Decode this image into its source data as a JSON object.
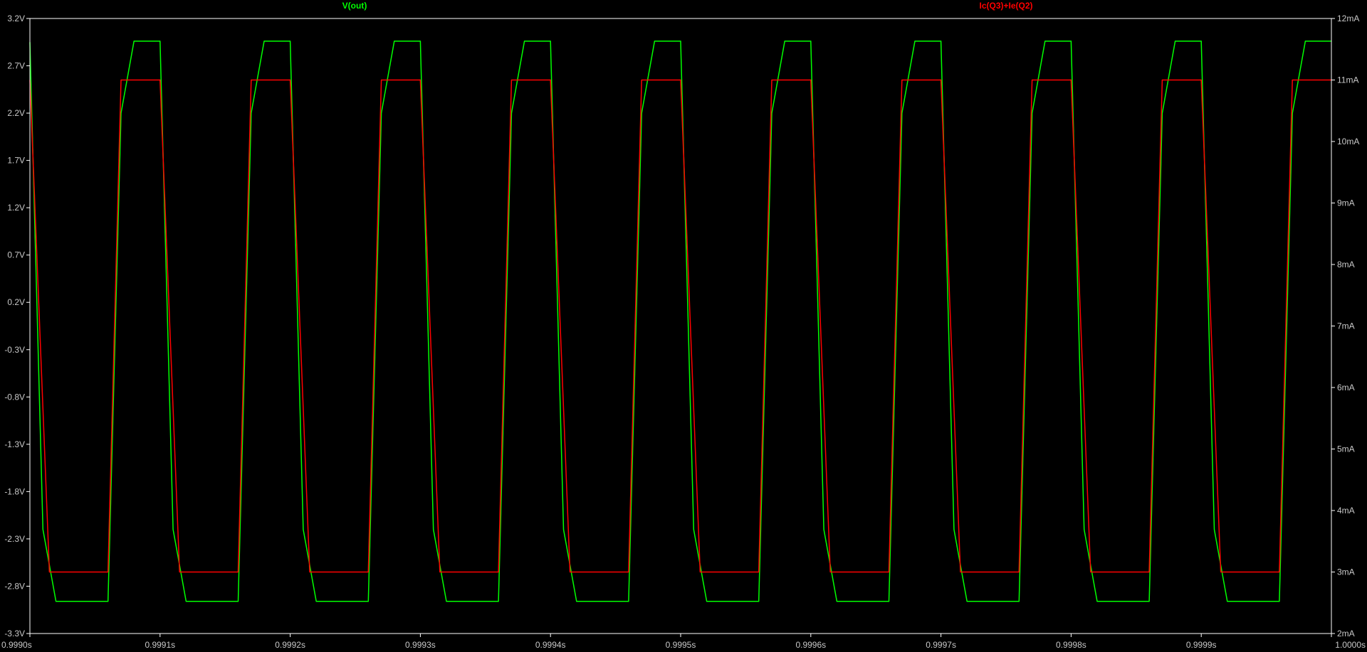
{
  "chart_data": {
    "type": "line",
    "background": "#000000",
    "axis_color": "#ffffff",
    "tick_label_color": "#c8c8c8",
    "grid": false,
    "x_axis": {
      "range": [
        0.999,
        1.0
      ],
      "unit": "s",
      "tick_labels": [
        "0.9990s",
        "0.9991s",
        "0.9992s",
        "0.9993s",
        "0.9994s",
        "0.9995s",
        "0.9996s",
        "0.9997s",
        "0.9998s",
        "0.9999s",
        "1.0000s"
      ],
      "tick_values": [
        0.999,
        0.9991,
        0.9992,
        0.9993,
        0.9994,
        0.9995,
        0.9996,
        0.9997,
        0.9998,
        0.9999,
        1.0
      ]
    },
    "y_left": {
      "range": [
        -3.3,
        3.2
      ],
      "unit": "V",
      "tick_labels": [
        "3.2V",
        "2.7V",
        "2.2V",
        "1.7V",
        "1.2V",
        "0.7V",
        "0.2V",
        "-0.3V",
        "-0.8V",
        "-1.3V",
        "-1.8V",
        "-2.3V",
        "-2.8V",
        "-3.3V"
      ],
      "tick_values": [
        3.2,
        2.7,
        2.2,
        1.7,
        1.2,
        0.7,
        0.2,
        -0.3,
        -0.8,
        -1.3,
        -1.8,
        -2.3,
        -2.8,
        -3.3
      ]
    },
    "y_right": {
      "range": [
        2,
        12
      ],
      "unit": "mA",
      "tick_labels": [
        "12mA",
        "11mA",
        "10mA",
        "9mA",
        "8mA",
        "7mA",
        "6mA",
        "5mA",
        "4mA",
        "3mA",
        "2mA"
      ],
      "tick_values": [
        12,
        11,
        10,
        9,
        8,
        7,
        6,
        5,
        4,
        3,
        2
      ]
    },
    "series": [
      {
        "name": "V(out)",
        "color": "#00ff00",
        "axis": "left",
        "x": [
          0.999,
          0.99901,
          0.99902,
          0.99906,
          0.99907,
          0.99908,
          0.9991,
          0.99911,
          0.99912,
          0.99916,
          0.99917,
          0.99918,
          0.9992,
          0.99921,
          0.99922,
          0.99926,
          0.99927,
          0.99928,
          0.9993,
          0.99931,
          0.99932,
          0.99936,
          0.99937,
          0.99938,
          0.9994,
          0.99941,
          0.99942,
          0.99946,
          0.99947,
          0.99948,
          0.9995,
          0.99951,
          0.99952,
          0.99956,
          0.99957,
          0.99958,
          0.9996,
          0.99961,
          0.99962,
          0.99966,
          0.99967,
          0.99968,
          0.9997,
          0.99971,
          0.99972,
          0.99976,
          0.99977,
          0.99978,
          0.9998,
          0.99981,
          0.99982,
          0.99986,
          0.99987,
          0.99988,
          0.9999,
          0.99991,
          0.99992,
          0.99996,
          0.99997,
          0.99998,
          1.0
        ],
        "y": [
          2.95,
          -2.2,
          -2.96,
          -2.96,
          2.2,
          2.96,
          2.96,
          -2.2,
          -2.96,
          -2.96,
          2.2,
          2.96,
          2.96,
          -2.2,
          -2.96,
          -2.96,
          2.2,
          2.96,
          2.96,
          -2.2,
          -2.96,
          -2.96,
          2.2,
          2.96,
          2.96,
          -2.2,
          -2.96,
          -2.96,
          2.2,
          2.96,
          2.96,
          -2.2,
          -2.96,
          -2.96,
          2.2,
          2.96,
          2.96,
          -2.2,
          -2.96,
          -2.96,
          2.2,
          2.96,
          2.96,
          -2.2,
          -2.96,
          -2.96,
          2.2,
          2.96,
          2.96,
          -2.2,
          -2.96,
          -2.96,
          2.2,
          2.96,
          2.96,
          -2.2,
          -2.96,
          -2.96,
          2.2,
          2.96,
          2.96
        ]
      },
      {
        "name": "Ic(Q3)+Ie(Q2)",
        "color": "#ff0000",
        "axis": "right",
        "x": [
          0.999,
          0.999015,
          0.99906,
          0.99907,
          0.999075,
          0.9991,
          0.999115,
          0.99916,
          0.99917,
          0.999175,
          0.9992,
          0.999215,
          0.99926,
          0.99927,
          0.999275,
          0.9993,
          0.999315,
          0.99936,
          0.99937,
          0.999375,
          0.9994,
          0.999415,
          0.99946,
          0.99947,
          0.999475,
          0.9995,
          0.999515,
          0.99956,
          0.99957,
          0.999575,
          0.9996,
          0.999615,
          0.99966,
          0.99967,
          0.999675,
          0.9997,
          0.999715,
          0.99976,
          0.99977,
          0.999775,
          0.9998,
          0.999815,
          0.99986,
          0.99987,
          0.999875,
          0.9999,
          0.999915,
          0.99996,
          0.99997,
          0.999975,
          1.0
        ],
        "y": [
          11,
          3,
          3,
          11,
          11,
          11,
          3,
          3,
          11,
          11,
          11,
          3,
          3,
          11,
          11,
          11,
          3,
          3,
          11,
          11,
          11,
          3,
          3,
          11,
          11,
          11,
          3,
          3,
          11,
          11,
          11,
          3,
          3,
          11,
          11,
          11,
          3,
          3,
          11,
          11,
          11,
          3,
          3,
          11,
          11,
          11,
          3,
          3,
          11,
          11,
          11
        ]
      }
    ]
  }
}
